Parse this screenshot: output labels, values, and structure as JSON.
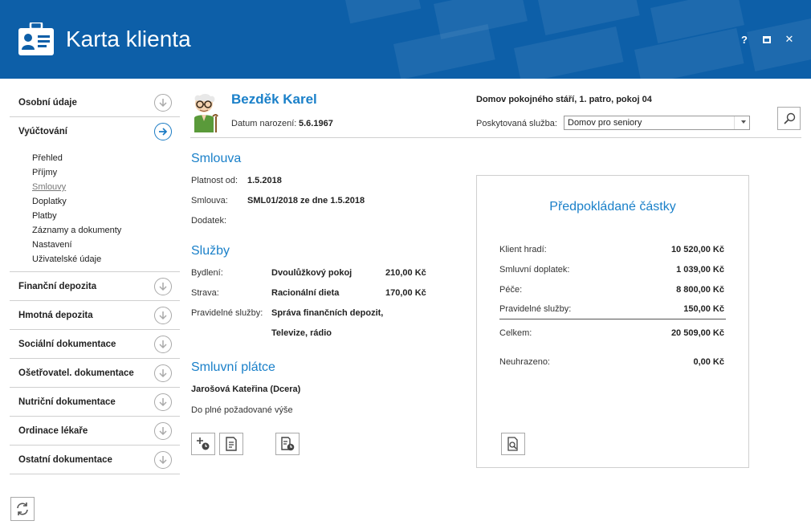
{
  "window": {
    "title": "Karta klienta",
    "buttons": {
      "help": "?",
      "close": "✕"
    }
  },
  "sidebar": {
    "items": [
      {
        "label": "Osobní údaje",
        "icon": "arrow-down-circle-icon"
      },
      {
        "label": "Vyúčtování",
        "icon": "arrow-right-circle-icon",
        "active": true
      },
      {
        "label": "Finanční depozita",
        "icon": "arrow-down-circle-icon"
      },
      {
        "label": "Hmotná depozita",
        "icon": "arrow-down-circle-icon"
      },
      {
        "label": "Sociální dokumentace",
        "icon": "arrow-down-circle-icon"
      },
      {
        "label": "Ošetřovatel. dokumentace",
        "icon": "arrow-down-circle-icon"
      },
      {
        "label": "Nutriční dokumentace",
        "icon": "arrow-down-circle-icon"
      },
      {
        "label": "Ordinace lékaře",
        "icon": "arrow-down-circle-icon"
      },
      {
        "label": "Ostatní dokumentace",
        "icon": "arrow-down-circle-icon"
      }
    ],
    "subitems": [
      "Přehled",
      "Příjmy",
      "Smlouvy",
      "Doplatky",
      "Platby",
      "Záznamy a dokumenty",
      "Nastavení",
      "Uživatelské údaje"
    ],
    "current_subitem": "Smlouvy"
  },
  "client": {
    "name": "Bezděk Karel",
    "dob_label": "Datum narození:",
    "dob_value": "5.6.1967",
    "home": "Domov pokojného stáří, 1. patro, pokoj 04",
    "service_label": "Poskytovaná služba:",
    "service_value": "Domov pro seniory"
  },
  "contract": {
    "title": "Smlouva",
    "valid_label": "Platnost od:",
    "valid_value": "1.5.2018",
    "contract_label": "Smlouva:",
    "contract_value": "SML01/2018 ze dne 1.5.2018",
    "addendum_label": "Dodatek:"
  },
  "services": {
    "title": "Služby",
    "housing_label": "Bydlení:",
    "housing_name": "Dvoulůžkový pokoj",
    "housing_price": "210,00 Kč",
    "food_label": "Strava:",
    "food_name": "Racionální dieta",
    "food_price": "170,00 Kč",
    "regular_label": "Pravidelné služby:",
    "regular_line1": "Správa finančních depozit,",
    "regular_line2": "Televize, rádio"
  },
  "payer": {
    "title": "Smluvní plátce",
    "name": "Jarošová Kateřina (Dcera)",
    "note": "Do plné požadované výše"
  },
  "summary": {
    "title": "Předpokládané částky",
    "client_pays_label": "Klient hradí:",
    "client_pays_value": "10 520,00 Kč",
    "contract_surcharge_label": "Smluvní doplatek:",
    "contract_surcharge_value": "1 039,00 Kč",
    "care_label": "Péče:",
    "care_value": "8 800,00 Kč",
    "regular_label": "Pravidelné služby:",
    "regular_value": "150,00 Kč",
    "total_label": "Celkem:",
    "total_value": "20 509,00 Kč",
    "unpaid_label": "Neuhrazeno:",
    "unpaid_value": "0,00 Kč"
  },
  "colors": {
    "header_bg": "#0d5fa8",
    "accent": "#1a80c9"
  }
}
